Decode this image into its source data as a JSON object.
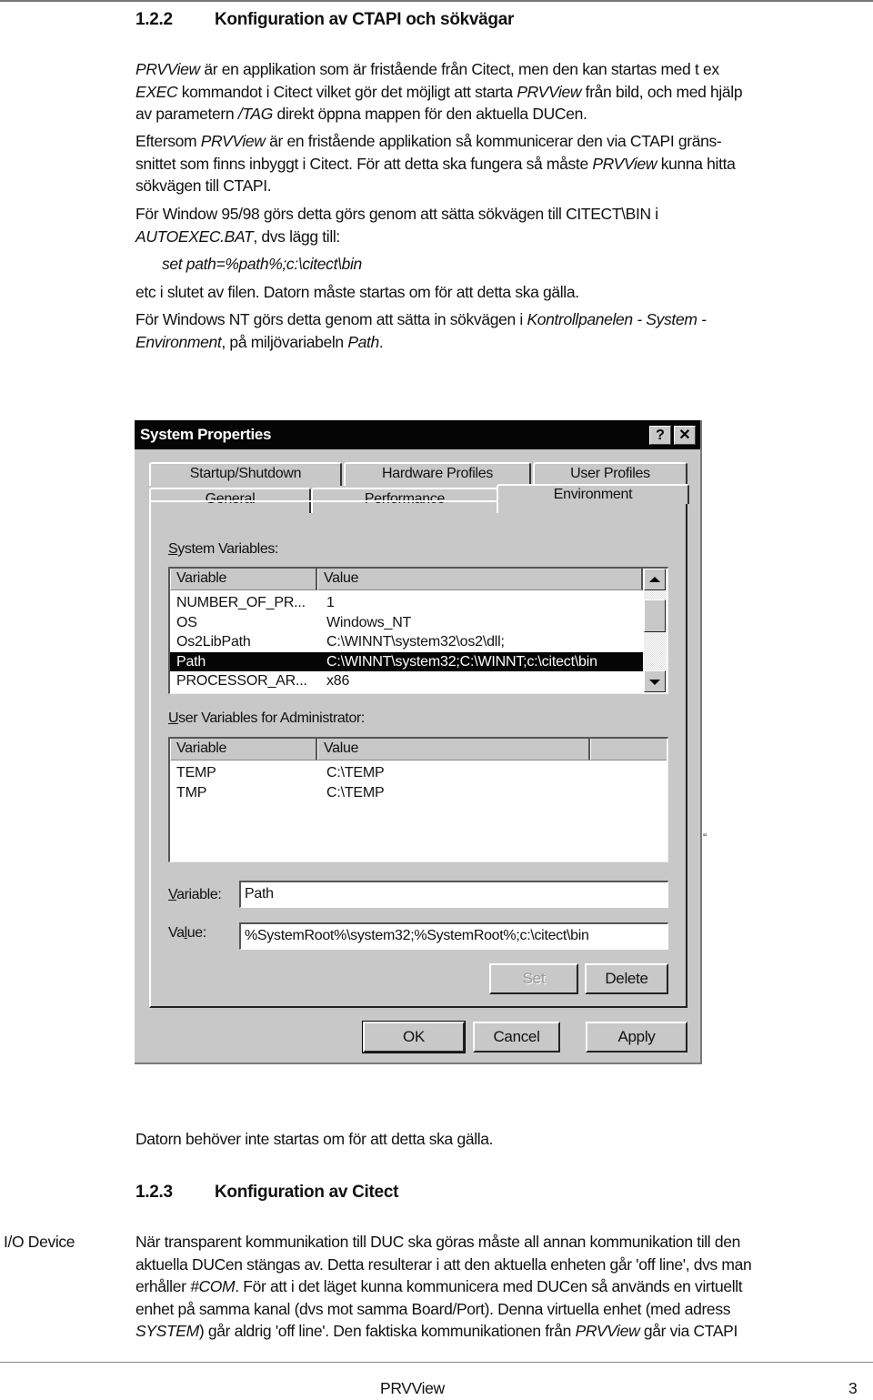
{
  "section1": {
    "number": "1.2.2",
    "title": "Konfiguration av CTAPI och sökvägar",
    "paragraphs": [
      [
        "PRVView",
        " är en applikation som är fristående från Citect, men den kan startas med t ex"
      ],
      [
        "EXEC",
        " kommandot i Citect vilket gör det möjligt att starta "
      ],
      [
        "PRVView",
        " från bild, och med hjälp"
      ],
      [
        "av parametern ",
        "/TAG",
        " direkt öppna mappen för den aktuella DUCen."
      ]
    ],
    "lines": {
      "l1_i": "PRVView",
      "l1": " är en applikation som är fristående från Citect, men den kan startas med t ex",
      "l2_i": "EXEC",
      "l2a": " kommandot i Citect vilket gör det möjligt att starta ",
      "l2_i2": "PRVView",
      "l2b": " från bild, och med hjälp",
      "l3a": "av parametern ",
      "l3_i": "/TAG",
      "l3b": " direkt öppna mappen för den aktuella DUCen.",
      "l4a": "Eftersom ",
      "l4_i": "PRVView",
      "l4b": " är en fristående applikation så kommunicerar den via CTAPI gräns-",
      "l5a": "snittet som finns inbyggt i Citect. För att detta ska fungera så måste ",
      "l5_i": "PRVView",
      "l5b": " kunna hitta",
      "l6": "sökvägen till CTAPI.",
      "l7": "För Window 95/98 görs detta görs genom att sätta sökvägen till CITECT\\BIN i",
      "l8_i": "AUTOEXEC.BAT",
      "l8": ", dvs lägg till:",
      "code": "set path=%path%;c:\\citect\\bin",
      "l9": "etc i slutet av filen. Datorn måste startas om för att detta ska gälla.",
      "l10a": "För Windows NT görs detta genom att sätta in sökvägen i ",
      "l10_i": "Kontrollpanelen - System -",
      "l11_i": "Environment",
      "l11a": ", på miljövariabeln ",
      "l11_i2": "Path",
      "l11b": "."
    }
  },
  "dialog": {
    "title": "System Properties",
    "help_glyph": "?",
    "close_glyph": "✕",
    "tabs_back": [
      "Startup/Shutdown",
      "Hardware Profiles",
      "User Profiles"
    ],
    "tabs_front": [
      "General",
      "Performance",
      "Environment"
    ],
    "active_tab": "Environment",
    "system_vars": {
      "label_u": "S",
      "label_rest": "ystem Variables:",
      "headers": [
        "Variable",
        "Value"
      ],
      "rows": [
        {
          "variable": "NUMBER_OF_PR...",
          "value": "1"
        },
        {
          "variable": "OS",
          "value": "Windows_NT"
        },
        {
          "variable": "Os2LibPath",
          "value": "C:\\WINNT\\system32\\os2\\dll;"
        },
        {
          "variable": "Path",
          "value": "C:\\WINNT\\system32;C:\\WINNT;c:\\citect\\bin",
          "selected": true
        },
        {
          "variable": "PROCESSOR_AR...",
          "value": "x86"
        }
      ]
    },
    "user_vars": {
      "label_u": "U",
      "label_rest": "ser Variables for Administrator:",
      "headers": [
        "Variable",
        "Value"
      ],
      "rows": [
        {
          "variable": "TEMP",
          "value": "C:\\TEMP"
        },
        {
          "variable": "TMP",
          "value": "C:\\TEMP"
        }
      ]
    },
    "variable_label_u": "V",
    "variable_label_rest": "ariable:",
    "variable_value": "Path",
    "value_label_a": "Va",
    "value_label_u": "l",
    "value_label_b": "ue:",
    "value_value": "%SystemRoot%\\system32;%SystemRoot%;c:\\citect\\bin",
    "set_button": "Set",
    "delete_button": "Delete",
    "ok_button": "OK",
    "cancel_button": "Cancel",
    "apply_button": "Apply"
  },
  "stray_mark": "“",
  "after_dialog": "Datorn behöver inte startas om för att detta ska gälla.",
  "section2": {
    "number": "1.2.3",
    "title": "Konfiguration av Citect",
    "margin_label": "I/O Device",
    "p1": "När transparent kommunikation till DUC ska göras måste all annan kommunikation till den",
    "p2": "aktuella DUCen stängas av. Detta resulterar i att den aktuella enheten går 'off line', dvs man",
    "p3a": "erhåller ",
    "p3_i": "#COM",
    "p3b": ". För att i det läget kunna kommunicera med DUCen så används en virtuellt",
    "p4": "enhet på samma kanal (dvs mot samma Board/Port). Denna virtuella enhet (med adress",
    "p5_i": "SYSTEM",
    "p5a": ") går aldrig 'off line'. Den faktiska kommunikationen från ",
    "p5_i2": "PRVView",
    "p5b": " går via CTAPI"
  },
  "footer": {
    "title": "PRVView",
    "page": "3"
  }
}
